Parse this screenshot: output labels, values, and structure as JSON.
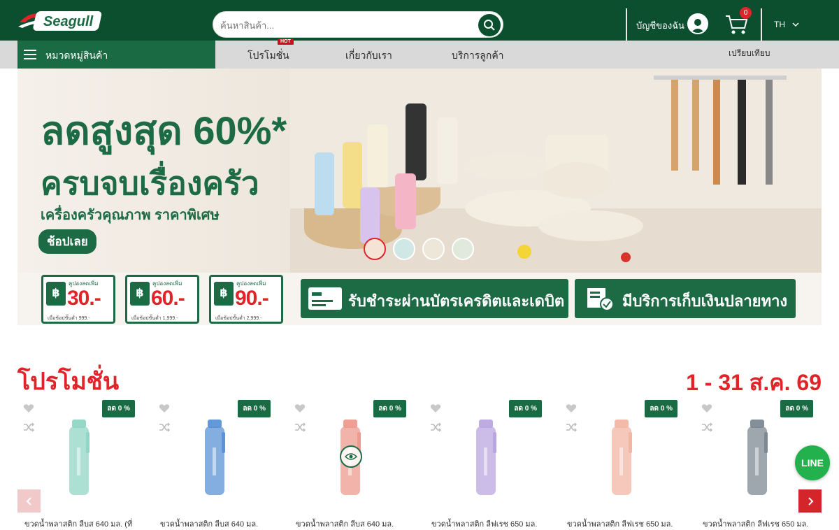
{
  "header": {
    "logo_text": "Seagull",
    "search_placeholder": "ค้นหาสินค้า...",
    "account_label": "บัญชีของฉัน",
    "cart_count": "0",
    "language": "TH",
    "icons": [
      "search-icon",
      "avatar-icon",
      "cart-icon",
      "chevron-down-icon"
    ]
  },
  "nav": {
    "category_label": "หมวดหมู่สินค้า",
    "links": [
      "โปรโมชั่น",
      "เกี่ยวกับเรา",
      "บริการลูกค้า"
    ],
    "hot_badge": "HOT",
    "compare_label": "เปรียบเทียบ"
  },
  "banner": {
    "headline_1": "ลดสูงสุด 60%*",
    "headline_2": "ครบจบเรื่องครัว",
    "subtitle": "เครื่องครัวคุณภาพ ราคาพิเศษ",
    "cta": "ช้อปเลย",
    "thumbnail_count": 4
  },
  "coupons": [
    {
      "top": "คูปองลดเพิ่ม",
      "amount": "30.-",
      "min": "เมื่อช้อปขั้นต่ำ 999.-"
    },
    {
      "top": "คูปองลดเพิ่ม",
      "amount": "60.-",
      "min": "เมื่อช้อปขั้นต่ำ 1,999.-"
    },
    {
      "top": "คูปองลดเพิ่ม",
      "amount": "90.-",
      "min": "เมื่อช้อปขั้นต่ำ 2,999.-"
    }
  ],
  "payment_badges": [
    {
      "label": "รับชำระผ่านบัตรเครดิตและเดบิต"
    },
    {
      "label": "มีบริการเก็บเงินปลายทาง"
    }
  ],
  "promo_section": {
    "title": "โปรโมชั่น",
    "date_range": "1 - 31 ส.ค. 69"
  },
  "products": [
    {
      "discount": "ลด 0 %",
      "name": "ขวดน้ำพลาสติก ลีบส 640 มล. (ที่",
      "color": "#8fd6c4"
    },
    {
      "discount": "ลด 0 %",
      "name": "ขวดน้ำพลาสติก ลีบส 640 มล.",
      "color": "#5b93d6"
    },
    {
      "discount": "ลด 0 %",
      "name": "ขวดน้ำพลาสติก ลีบส 640 มล.",
      "color": "#ee9a8e"
    },
    {
      "discount": "ลด 0 %",
      "name": "ขวดน้ำพลาสติก ลีฟเรช 650 มล.",
      "color": "#b9a6e0"
    },
    {
      "discount": "ลด 0 %",
      "name": "ขวดน้ำพลาสติก ลีฟเรช 650 มล.",
      "color": "#f2b6a4"
    },
    {
      "discount": "ลด 0 %",
      "name": "ขวดน้ำพลาสติก ลีฟเรช 650 มล.",
      "color": "#7d8a93"
    }
  ],
  "floating": {
    "line_label": "LINE"
  },
  "colors": {
    "brand_green": "#0b4f2f",
    "accent_red": "#e0242a",
    "line_green": "#22b14c"
  }
}
